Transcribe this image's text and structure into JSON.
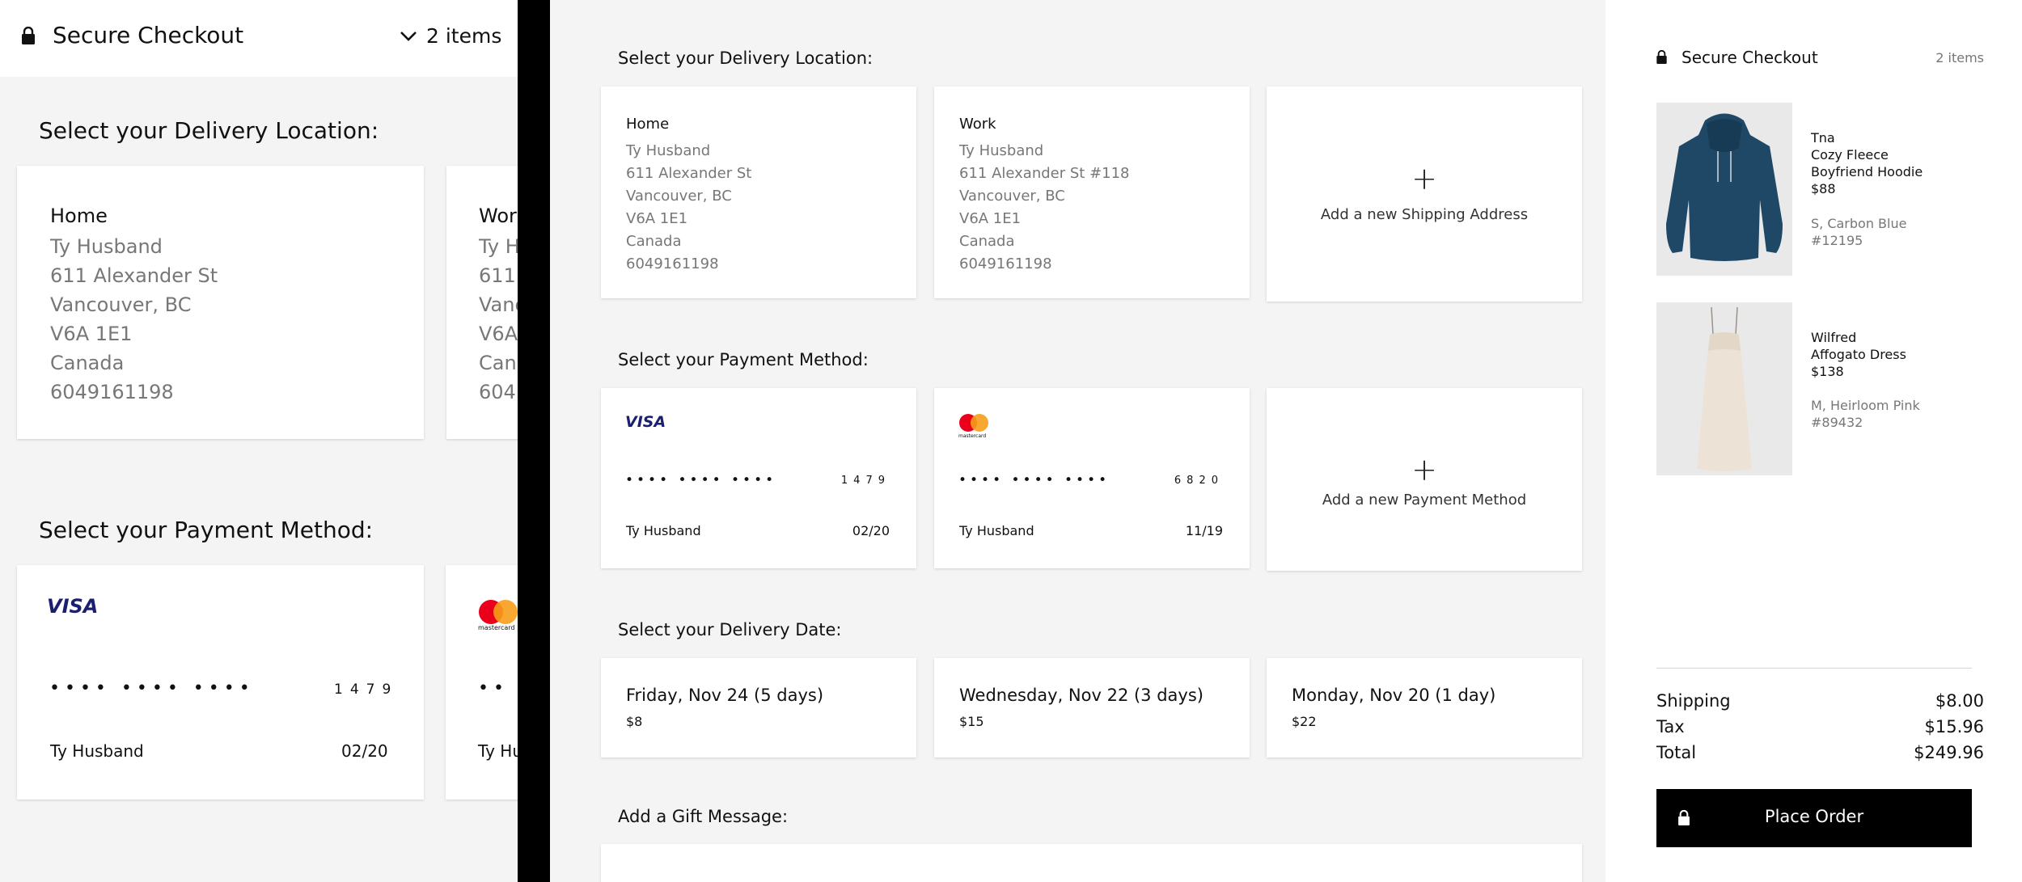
{
  "mobile": {
    "header": {
      "title": "Secure Checkout",
      "items_label": "2 items"
    },
    "delivery_section_title": "Select your Delivery Location:",
    "payment_section_title": "Select your Payment Method:",
    "addresses": [
      {
        "name": "Home",
        "lines": [
          "Ty Husband",
          "611 Alexander St",
          "Vancouver, BC",
          "V6A 1E1",
          "Canada",
          "6049161198"
        ]
      },
      {
        "name": "Wor",
        "lines": [
          "Ty H",
          "611 A",
          "Vanc",
          "V6A",
          "Can",
          "604"
        ]
      }
    ],
    "cards": [
      {
        "brand": "VISA",
        "dots": "•••• •••• ••••",
        "last4": "1479",
        "holder": "Ty Husband",
        "expiry": "02/20"
      },
      {
        "brand": "mastercard",
        "dots": "••",
        "holder": "Ty Hu"
      }
    ]
  },
  "checkout": {
    "delivery_section_title": "Select your Delivery Location:",
    "addresses": [
      {
        "name": "Home",
        "lines": [
          "Ty Husband",
          "611 Alexander St",
          "Vancouver, BC",
          "V6A 1E1",
          "Canada",
          "6049161198"
        ]
      },
      {
        "name": "Work",
        "lines": [
          "Ty Husband",
          "611 Alexander St #118",
          "Vancouver, BC",
          "V6A 1E1",
          "Canada",
          "6049161198"
        ]
      }
    ],
    "add_address": {
      "plus": "+",
      "label": "Add a new Shipping Address"
    },
    "payment_section_title": "Select your Payment Method:",
    "cards": [
      {
        "brand": "VISA",
        "dots": "•••• •••• ••••",
        "last4": "1479",
        "holder": "Ty Husband",
        "expiry": "02/20"
      },
      {
        "brand": "mastercard",
        "dots": "•••• •••• ••••",
        "last4": "6820",
        "holder": "Ty Husband",
        "expiry": "11/19"
      }
    ],
    "add_payment": {
      "plus": "+",
      "label": "Add a new Payment Method"
    },
    "date_section_title": "Select your Delivery Date:",
    "delivery_dates": [
      {
        "label": "Friday, Nov 24 (5 days)",
        "price": "$8"
      },
      {
        "label": "Wednesday, Nov 22 (3 days)",
        "price": "$15"
      },
      {
        "label": "Monday, Nov 20 (1 day)",
        "price": "$22"
      }
    ],
    "gift_section_title": "Add a Gift Message:"
  },
  "summary": {
    "title": "Secure Checkout",
    "items_label": "2 items",
    "products": [
      {
        "brand": "Tna",
        "name_line1": "Cozy Fleece",
        "name_line2": "Boyfriend Hoodie",
        "price": "$88",
        "variant": "S, Carbon Blue",
        "sku": "#12195",
        "color": "#1f4766"
      },
      {
        "brand": "Wilfred",
        "name_line1": "Affogato Dress",
        "name_line2": "",
        "price": "$138",
        "variant": "M, Heirloom Pink",
        "sku": "#89432",
        "color": "#ece3d6"
      }
    ],
    "totals": [
      {
        "label": "Shipping",
        "value": "$8.00"
      },
      {
        "label": "Tax",
        "value": "$15.96"
      },
      {
        "label": "Total",
        "value": "$249.96"
      }
    ],
    "place_order_label": "Place Order"
  },
  "colors": {
    "visa_blue": "#1a1f71",
    "mc_red": "#eb001b",
    "mc_orange": "#f79e1b",
    "muted_text": "#777777",
    "page_bg": "#f4f4f4"
  }
}
